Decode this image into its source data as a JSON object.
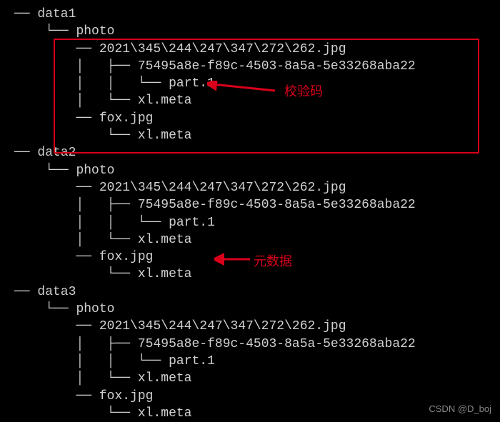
{
  "tree": {
    "data1": {
      "name": "data1",
      "photo": "photo",
      "jpg_long": "2021\\345\\244\\247\\347\\272\\262.jpg",
      "uuid": "75495a8e-f89c-4503-8a5a-5e33268aba22",
      "part": "part.1",
      "xlmeta1": "xl.meta",
      "fox": "fox.jpg",
      "xlmeta2": "xl.meta"
    },
    "data2": {
      "name": "data2",
      "photo": "photo",
      "jpg_long": "2021\\345\\244\\247\\347\\272\\262.jpg",
      "uuid": "75495a8e-f89c-4503-8a5a-5e33268aba22",
      "part": "part.1",
      "xlmeta1": "xl.meta",
      "fox": "fox.jpg",
      "xlmeta2": "xl.meta"
    },
    "data3": {
      "name": "data3",
      "photo": "photo",
      "jpg_long": "2021\\345\\244\\247\\347\\272\\262.jpg",
      "uuid": "75495a8e-f89c-4503-8a5a-5e33268aba22",
      "part": "part.1",
      "xlmeta1": "xl.meta",
      "fox": "fox.jpg",
      "xlmeta2": "xl.meta"
    }
  },
  "annotations": {
    "checksum": "校验码",
    "metadata": "元数据"
  },
  "watermark": "CSDN @D_boj",
  "branch": {
    "h": "── ",
    "mid": "├── ",
    "last": "└── ",
    "pipe": "│   ",
    "space": "    "
  }
}
